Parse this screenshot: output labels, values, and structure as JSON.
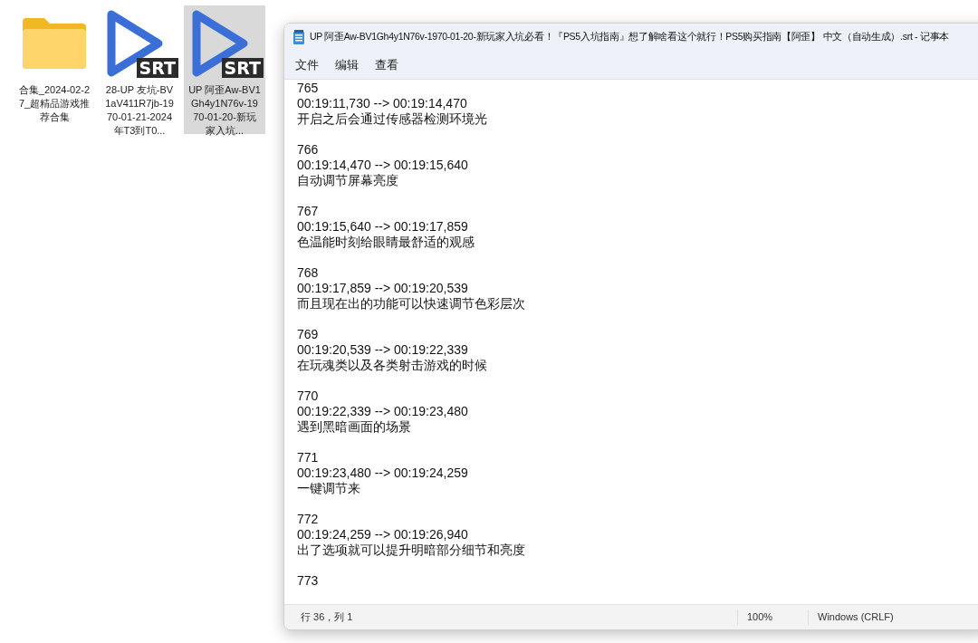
{
  "desktop_icons": [
    {
      "kind": "folder",
      "label": "合集_2024-02-27_超精品游戏推荐合集",
      "selected": false
    },
    {
      "kind": "srt",
      "badge": "SRT",
      "label": "28-UP 友坑-BV1aV411R7jb-1970-01-21-2024年T3到T0...",
      "selected": false
    },
    {
      "kind": "srt",
      "badge": "SRT",
      "label": "UP 阿歪Aw-BV1Gh4y1N76v-1970-01-20-新玩家入坑...",
      "selected": true
    }
  ],
  "window": {
    "title": "UP 阿歪Aw-BV1Gh4y1N76v-1970-01-20-新玩家入坑必看！『PS5入坑指南』想了解啥看这个就行！PS5购买指南【阿歪】 中文（自动生成）.srt - 记事本",
    "menu": [
      "文件",
      "编辑",
      "查看"
    ],
    "entries": [
      {
        "index": "765",
        "time": "00:19:11,730 --> 00:19:14,470",
        "text": "开启之后会通过传感器检测环境光"
      },
      {
        "index": "766",
        "time": "00:19:14,470 --> 00:19:15,640",
        "text": "自动调节屏幕亮度"
      },
      {
        "index": "767",
        "time": "00:19:15,640 --> 00:19:17,859",
        "text": "色温能时刻给眼睛最舒适的观感"
      },
      {
        "index": "768",
        "time": "00:19:17,859 --> 00:19:20,539",
        "text": "而且现在出的功能可以快速调节色彩层次"
      },
      {
        "index": "769",
        "time": "00:19:20,539 --> 00:19:22,339",
        "text": "在玩魂类以及各类射击游戏的时候"
      },
      {
        "index": "770",
        "time": "00:19:22,339 --> 00:19:23,480",
        "text": "遇到黑暗画面的场景"
      },
      {
        "index": "771",
        "time": "00:19:23,480 --> 00:19:24,259",
        "text": "一键调节来"
      },
      {
        "index": "772",
        "time": "00:19:24,259 --> 00:19:26,940",
        "text": "出了选项就可以提升明暗部分细节和亮度"
      },
      {
        "index": "773"
      }
    ],
    "status_bar": {
      "position": "行 36，列 1",
      "zoom": "100%",
      "line_ending": "Windows (CRLF)"
    }
  }
}
